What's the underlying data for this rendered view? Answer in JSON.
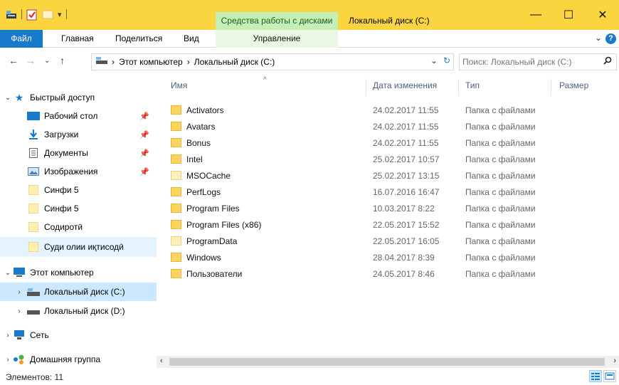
{
  "titlebar": {
    "context_tab": "Средства работы с дисками",
    "window_title": "Локальный диск (C:)",
    "minimize": "—",
    "maximize": "☐",
    "close": "✕"
  },
  "ribbon": {
    "tabs": [
      "Файл",
      "Главная",
      "Поделиться",
      "Вид",
      "Управление"
    ],
    "collapse": "⌄",
    "help": "?"
  },
  "address": {
    "crumbs": [
      "Этот компьютер",
      "Локальный диск (C:)"
    ],
    "separator": "›"
  },
  "search": {
    "placeholder": "Поиск: Локальный диск (C:)"
  },
  "navpane": {
    "quick_access": "Быстрый доступ",
    "items": [
      {
        "label": "Рабочий стол",
        "icon": "desktop-icon",
        "pinned": true
      },
      {
        "label": "Загрузки",
        "icon": "downloads-icon",
        "pinned": true
      },
      {
        "label": "Документы",
        "icon": "documents-icon",
        "pinned": true
      },
      {
        "label": "Изображения",
        "icon": "pictures-icon",
        "pinned": true
      },
      {
        "label": "Синфи 5",
        "icon": "folder-icon",
        "pinned": false
      },
      {
        "label": "Синфи 5",
        "icon": "folder-icon",
        "pinned": false
      },
      {
        "label": "Содиротӣ",
        "icon": "folder-icon",
        "pinned": false
      },
      {
        "label": "Суди олии иқтисодӣ",
        "icon": "folder-icon",
        "pinned": false
      }
    ],
    "this_pc": "Этот компьютер",
    "drive_c": "Локальный диск (C:)",
    "drive_d": "Локальный диск (D:)",
    "network": "Сеть",
    "homegroup": "Домашняя группа"
  },
  "filelist": {
    "columns": [
      "Имя",
      "Дата изменения",
      "Тип",
      "Размер"
    ],
    "rows": [
      {
        "name": "Activators",
        "date": "24.02.2017 11:55",
        "type": "Папка с файлами"
      },
      {
        "name": "Avatars",
        "date": "24.02.2017 11:55",
        "type": "Папка с файлами"
      },
      {
        "name": "Bonus",
        "date": "24.02.2017 11:55",
        "type": "Папка с файлами"
      },
      {
        "name": "Intel",
        "date": "25.02.2017 10:57",
        "type": "Папка с файлами"
      },
      {
        "name": "MSOCache",
        "date": "25.02.2017 13:15",
        "type": "Папка с файлами"
      },
      {
        "name": "PerfLogs",
        "date": "16.07.2016 16:47",
        "type": "Папка с файлами"
      },
      {
        "name": "Program Files",
        "date": "10.03.2017 8:22",
        "type": "Папка с файлами"
      },
      {
        "name": "Program Files (x86)",
        "date": "22.05.2017 15:52",
        "type": "Папка с файлами"
      },
      {
        "name": "ProgramData",
        "date": "22.05.2017 16:05",
        "type": "Папка с файлами"
      },
      {
        "name": "Windows",
        "date": "28.04.2017 8:39",
        "type": "Папка с файлами"
      },
      {
        "name": "Пользователи",
        "date": "24.05.2017 8:46",
        "type": "Папка с файлами"
      }
    ]
  },
  "statusbar": {
    "count": "Элементов: 11"
  },
  "colors": {
    "titlebar": "#fad53f",
    "context_tab": "#c6efb8",
    "file_tab": "#1979ca",
    "selected": "#cce8ff",
    "folder": "#fbd35d"
  }
}
